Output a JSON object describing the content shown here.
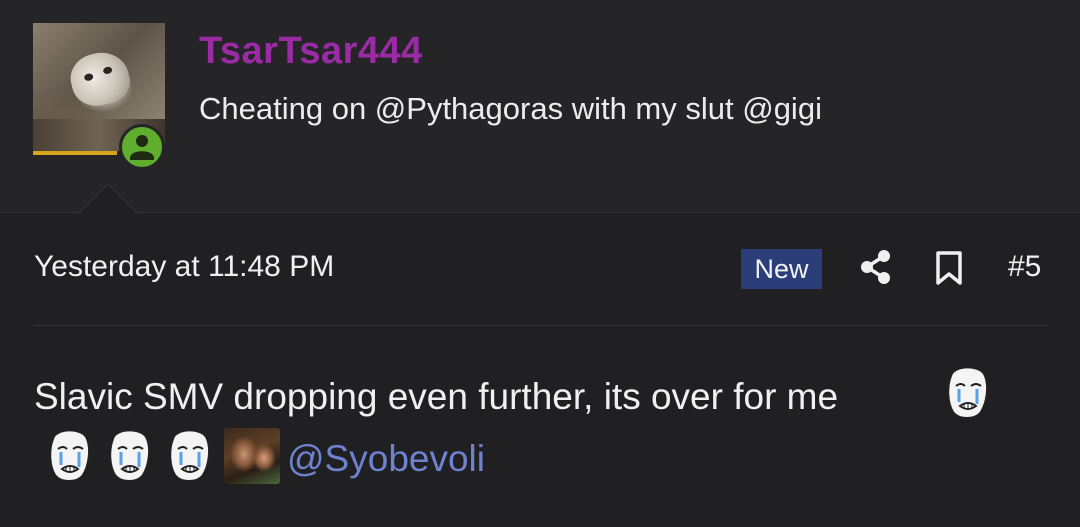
{
  "post": {
    "author": {
      "username": "TsarTsar444",
      "title": "Cheating on @Pythagoras with my slut @gigi",
      "avatar_icon": "cat-avatar",
      "status_icon": "user-online-icon",
      "username_color": "#9b2aa5"
    },
    "meta": {
      "timestamp": "Yesterday at 11:48 PM",
      "badge": "New",
      "badge_color": "#2b3e7a",
      "share_icon": "share-icon",
      "bookmark_icon": "bookmark-icon",
      "post_number": "#5"
    },
    "content": {
      "text": "Slavic SMV dropping even further, its over for me",
      "emojis": [
        "crying-wojak-emoji",
        "crying-wojak-emoji",
        "crying-wojak-emoji",
        "crying-wojak-emoji"
      ],
      "gif_icon": "gif-thumbnail",
      "mention": "@Syobevoli",
      "mention_color": "#6e82cf"
    }
  }
}
